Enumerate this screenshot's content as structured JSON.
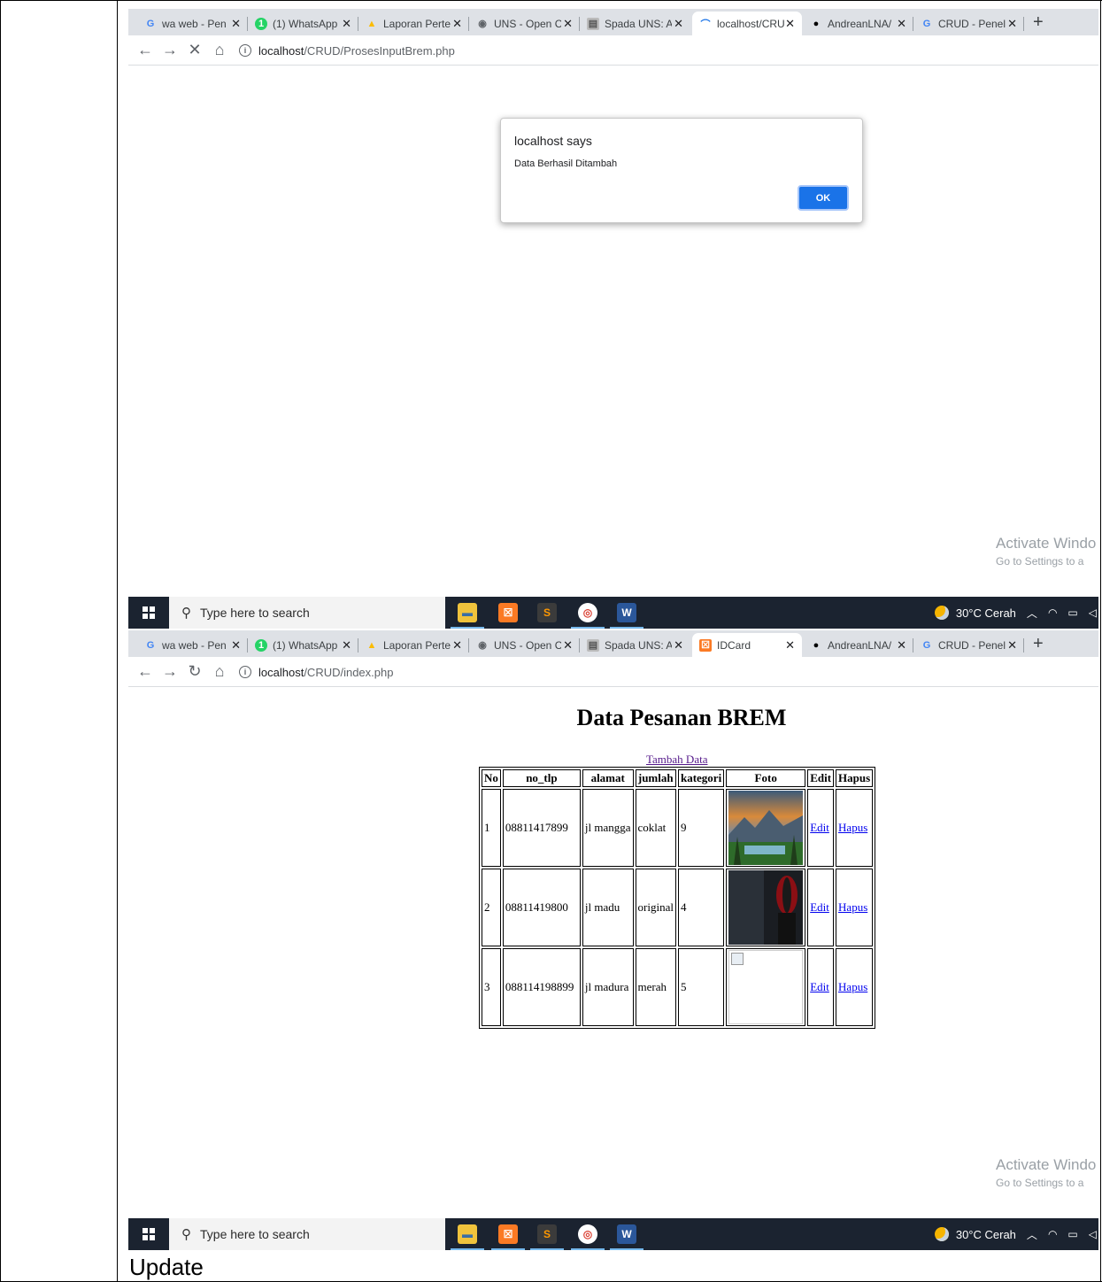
{
  "tabs_top": [
    "wa web - Pen",
    "(1) WhatsApp",
    "Laporan Perte",
    "UNS - Open C",
    "Spada UNS: A",
    "localhost/CRU",
    "AndreanLNA/",
    "CRUD - Penel"
  ],
  "tabs_bottom": [
    "wa web - Pen",
    "(1) WhatsApp",
    "Laporan Perte",
    "UNS - Open C",
    "Spada UNS: A",
    "IDCard",
    "AndreanLNA/",
    "CRUD - Penel"
  ],
  "shot1": {
    "url_host": "localhost",
    "url_path": "/CRUD/ProsesInputBrem.php",
    "dialog": {
      "title": "localhost says",
      "message": "Data Berhasil Ditambah",
      "ok": "OK"
    }
  },
  "shot2": {
    "url_host": "localhost",
    "url_path": "/CRUD/index.php",
    "heading": "Data Pesanan BREM",
    "add_link": "Tambah Data",
    "columns": [
      "No",
      "no_tlp",
      "alamat",
      "jumlah",
      "kategori",
      "Foto",
      "Edit",
      "Hapus"
    ],
    "rows": [
      {
        "no": "1",
        "no_tlp": "08811417899",
        "alamat": "jl mangga",
        "jumlah": "coklat",
        "kategori": "9",
        "edit": "Edit",
        "hapus": "Hapus"
      },
      {
        "no": "2",
        "no_tlp": "08811419800",
        "alamat": "jl madu",
        "jumlah": "original",
        "kategori": "4",
        "edit": "Edit",
        "hapus": "Hapus"
      },
      {
        "no": "3",
        "no_tlp": "088114198899",
        "alamat": "jl madura",
        "jumlah": "merah",
        "kategori": "5",
        "edit": "Edit",
        "hapus": "Hapus"
      }
    ]
  },
  "watermark": {
    "line1": "Activate Windo",
    "line2": "Go to Settings to a"
  },
  "taskbar": {
    "search_placeholder": "Type here to search",
    "weather": "30°C  Cerah"
  },
  "caption": "Update",
  "colors": {
    "accent": "#1a73e8",
    "taskbar": "#1b2330",
    "tabstrip": "#dee1e6"
  }
}
